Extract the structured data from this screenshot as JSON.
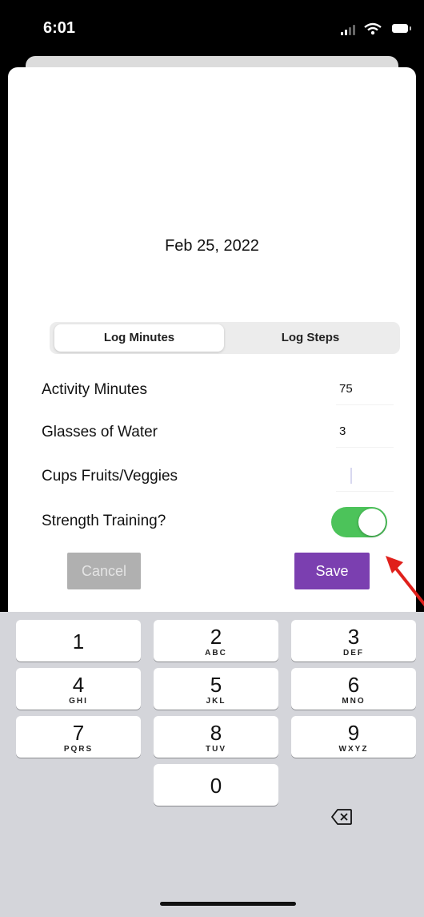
{
  "status_bar": {
    "time": "6:01"
  },
  "date_label": "Feb 25, 2022",
  "segmented": {
    "tab1": "Log Minutes",
    "tab2": "Log Steps",
    "selected": "Log Minutes"
  },
  "form": {
    "activity_minutes": {
      "label": "Activity Minutes",
      "value": "75"
    },
    "glasses_water": {
      "label": "Glasses of Water",
      "value": "3"
    },
    "cups_fruits": {
      "label": "Cups Fruits/Veggies",
      "value": ""
    },
    "strength_training": {
      "label": "Strength Training?",
      "on": true
    }
  },
  "buttons": {
    "cancel": "Cancel",
    "save": "Save"
  },
  "keyboard": {
    "k1": {
      "digit": "1",
      "letters": ""
    },
    "k2": {
      "digit": "2",
      "letters": "ABC"
    },
    "k3": {
      "digit": "3",
      "letters": "DEF"
    },
    "k4": {
      "digit": "4",
      "letters": "GHI"
    },
    "k5": {
      "digit": "5",
      "letters": "JKL"
    },
    "k6": {
      "digit": "6",
      "letters": "MNO"
    },
    "k7": {
      "digit": "7",
      "letters": "PQRS"
    },
    "k8": {
      "digit": "8",
      "letters": "TUV"
    },
    "k9": {
      "digit": "9",
      "letters": "WXYZ"
    },
    "k0": {
      "digit": "0",
      "letters": ""
    }
  },
  "colors": {
    "save": "#7b3fb0",
    "toggle_on": "#4cc35a",
    "annotation_arrow": "#e0201b"
  },
  "icons": {
    "backspace": "delete-left-icon"
  }
}
